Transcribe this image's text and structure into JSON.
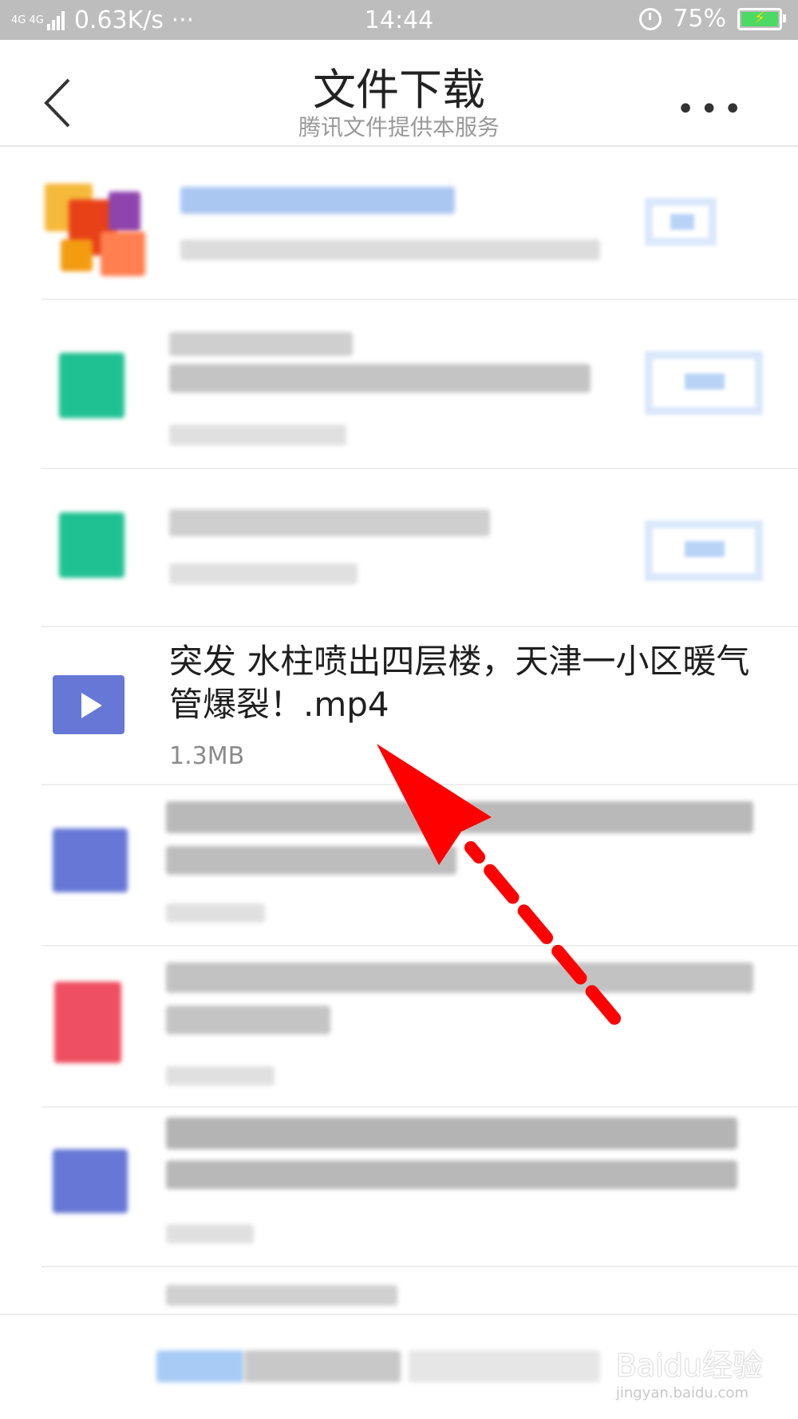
{
  "status_bar": {
    "network": "4G 4G",
    "speed": "0.63K/s ···",
    "time": "14:44",
    "battery": "75%"
  },
  "header": {
    "title": "文件下载",
    "subtitle": "腾讯文件提供本服务",
    "back_icon": "chevron-left-icon",
    "more_icon": "more-dots-icon",
    "more_label": "•••"
  },
  "files": {
    "highlighted": {
      "name": "突发 水柱喷出四层楼，天津一小区暖气管爆裂！.mp4",
      "size": "1.3MB",
      "icon": "video-file-icon"
    }
  },
  "colors": {
    "video_icon": "#6677d6",
    "apk_icon": "#1fc192",
    "doc_icon": "#ef4f62",
    "accent_blue": "#b9d3f7",
    "arrow": "#ff0000"
  },
  "watermark": {
    "logo": "Baidu经验",
    "url": "jingyan.baidu.com"
  }
}
